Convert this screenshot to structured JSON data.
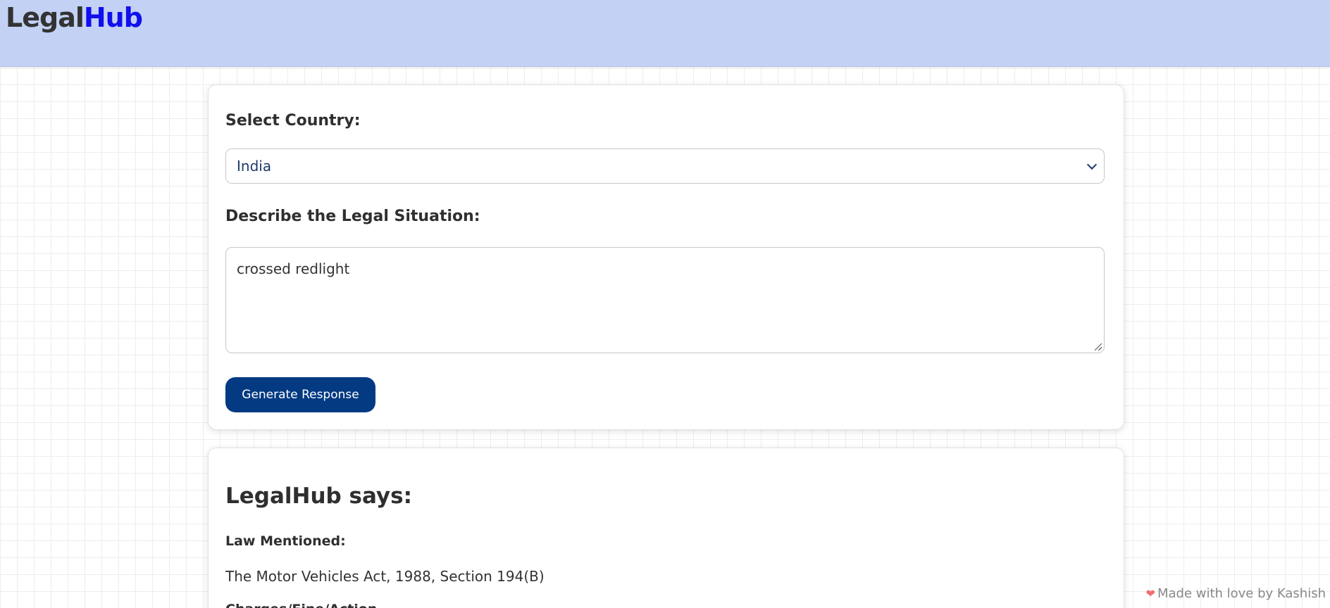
{
  "header": {
    "logo_part1": "Legal",
    "logo_part2": "Hub"
  },
  "form": {
    "country_label": "Select Country:",
    "country_selected": "India",
    "situation_label": "Describe the Legal Situation:",
    "situation_value": "crossed redlight",
    "generate_button": "Generate Response"
  },
  "response": {
    "title": "LegalHub says:",
    "law_label": "Law Mentioned:",
    "law_text": "The Motor Vehicles Act, 1988, Section 194(B)",
    "next_label": "Charges/Fine/Action"
  },
  "footer": {
    "heart_icon": "heart-icon",
    "text": "Made with love by Kashish"
  },
  "colors": {
    "header_bg": "#c3d1f4",
    "logo_accent": "#1010ee",
    "button_bg": "#033a82"
  }
}
